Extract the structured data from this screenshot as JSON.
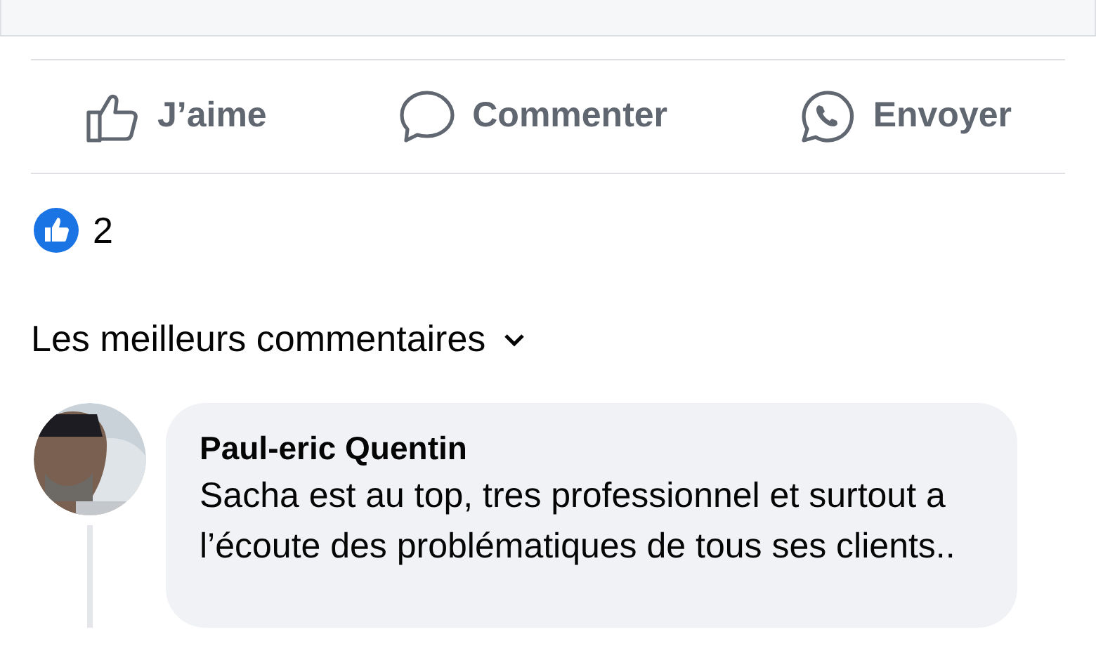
{
  "actions": [
    {
      "kind": "like",
      "label": "J’aime"
    },
    {
      "kind": "comment",
      "label": "Commenter"
    },
    {
      "kind": "send",
      "label": "Envoyer"
    }
  ],
  "reactions": {
    "count": "2"
  },
  "comments_header": {
    "label": "Les meilleurs commentaires"
  },
  "comments": [
    {
      "author": "Paul-eric Quentin",
      "text": "Sacha est au top, tres professionnel et surtout a l’écoute des problématiques de tous ses clients.."
    }
  ]
}
